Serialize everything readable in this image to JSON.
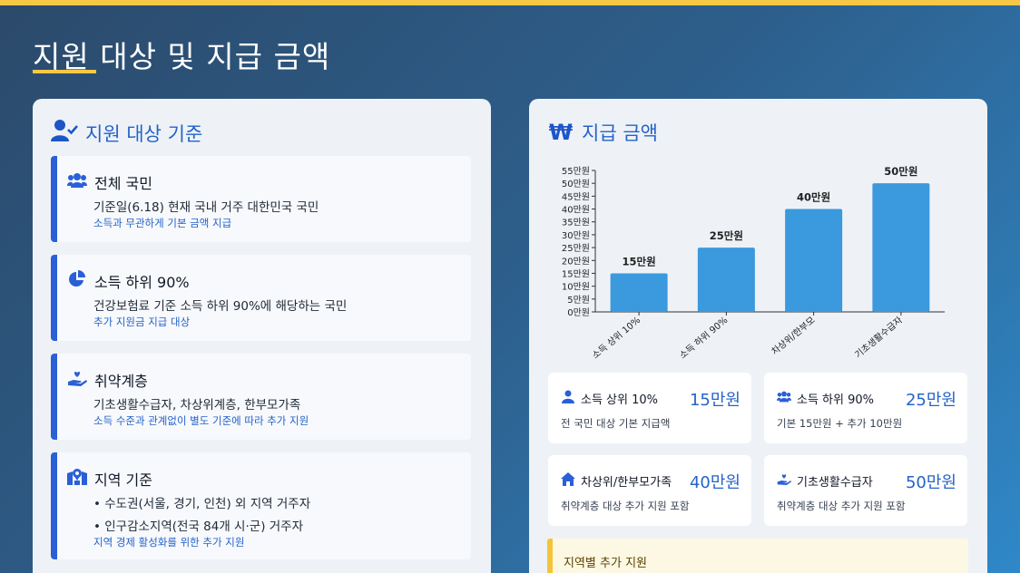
{
  "page": {
    "title": "지원 대상 및 지급 금액"
  },
  "colors": {
    "accent": "#f7c846",
    "primary_blue": "#2563c9",
    "bar_blue": "#3b99de",
    "card_border": "#2a5fd6"
  },
  "left_panel": {
    "title": "지원 대상 기준",
    "title_icon": "user-check-icon",
    "cards": [
      {
        "icon": "users-icon",
        "title": "전체 국민",
        "lines": [
          "기준일(6.18) 현재 국내 거주 대한민국 국민"
        ],
        "note": "소득과 무관하게 기본 금액 지급"
      },
      {
        "icon": "pie-chart-icon",
        "title": "소득 하위 90%",
        "lines": [
          "건강보험료 기준 소득 하위 90%에 해당하는 국민"
        ],
        "note": "추가 지원금 지급 대상"
      },
      {
        "icon": "hand-holding-heart-icon",
        "title": "취약계층",
        "lines": [
          "기초생활수급자, 차상위계층, 한부모가족"
        ],
        "note": "소득 수준과 관계없이 별도 기준에 따라 추가 지원"
      },
      {
        "icon": "map-location-icon",
        "title": "지역 기준",
        "lines": [
          "• 수도권(서울, 경기, 인천) 외 지역 거주자",
          "• 인구감소지역(전국 84개 시·군) 거주자"
        ],
        "note": "지역 경제 활성화를 위한 추가 지원"
      }
    ]
  },
  "right_panel": {
    "title": "지급 금액",
    "title_icon": "won-sign-icon",
    "title_symbol": "₩",
    "amount_cards": [
      {
        "icon": "user-icon",
        "label": "소득 상위 10%",
        "value": "15만원",
        "desc": "전 국민 대상 기본 지급액"
      },
      {
        "icon": "users-icon",
        "label": "소득 하위 90%",
        "value": "25만원",
        "desc": "기본 15만원 + 추가 10만원"
      },
      {
        "icon": "home-icon",
        "label": "차상위/한부모가족",
        "value": "40만원",
        "desc": "취약계층 대상 추가 지원 포함"
      },
      {
        "icon": "hand-holding-heart-icon",
        "label": "기초생활수급자",
        "value": "50만원",
        "desc": "취약계층 대상 추가 지원 포함"
      }
    ],
    "region_title": "지역별 추가 지원"
  },
  "chart_data": {
    "type": "bar",
    "categories": [
      "소득 상위 10%",
      "소득 하위 90%",
      "차상위/한부모",
      "기초생활수급자"
    ],
    "values": [
      15,
      25,
      40,
      50
    ],
    "data_labels": [
      "15만원",
      "25만원",
      "40만원",
      "50만원"
    ],
    "y_ticks": [
      "0만원",
      "5만원",
      "10만원",
      "15만원",
      "20만원",
      "25만원",
      "30만원",
      "35만원",
      "40만원",
      "45만원",
      "50만원",
      "55만원"
    ],
    "ylim": [
      0,
      55
    ],
    "grid": false,
    "legend": "none"
  }
}
